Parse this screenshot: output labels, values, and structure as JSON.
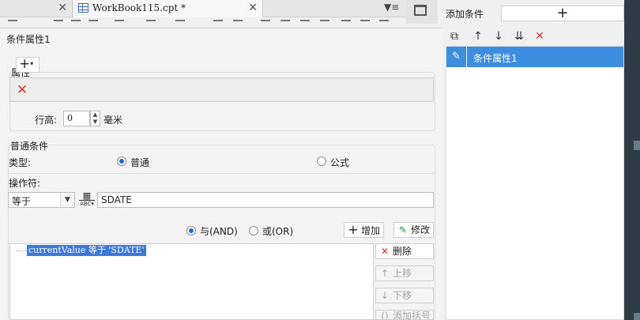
{
  "tabs": [
    {
      "label": ""
    },
    {
      "label": "WorkBook115.cpt *"
    }
  ],
  "dialog": {
    "title": "条件属性1",
    "properties": {
      "label": "属性",
      "row_height_label": "行高:",
      "row_height_value": "0",
      "unit": "毫米"
    },
    "normal_conditions": {
      "label": "普通条件",
      "type_label": "类型:",
      "type_options": [
        "普通",
        "公式"
      ],
      "type_selected": "普通",
      "operator_label": "操作符:",
      "operator_value": "等于",
      "value_field": "SDATE",
      "logic_options": [
        "与(AND)",
        "或(OR)"
      ],
      "logic_selected": "与(AND)",
      "add_label": "增加",
      "modify_label": "修改",
      "delete_label": "删除",
      "move_up_label": "上移",
      "move_down_label": "下移",
      "add_bracket_label": "添加括号",
      "conditions": [
        "currentValue 等于 'SDATE'"
      ]
    }
  },
  "right_panel": {
    "title": "添加条件",
    "items": [
      "条件属性1"
    ]
  },
  "colors": {
    "selection": "#3b78d8",
    "panel_selection": "#3d8ee0",
    "delete": "#d93030"
  }
}
